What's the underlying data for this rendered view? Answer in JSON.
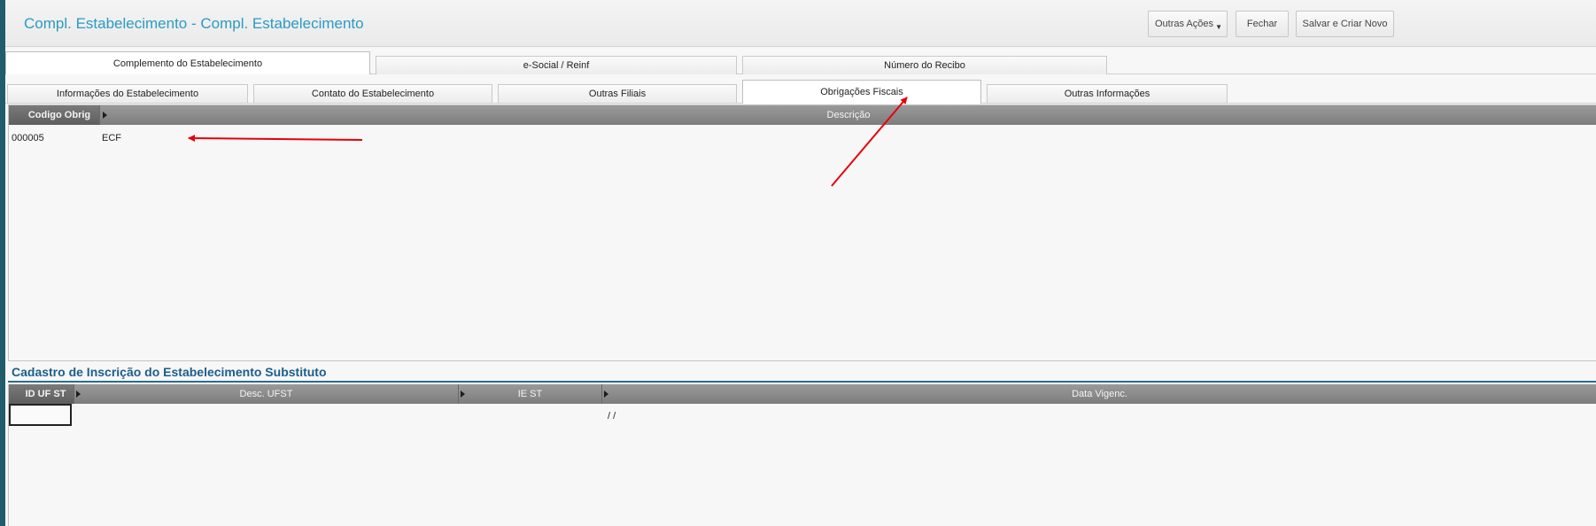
{
  "window": {
    "title": "Compl. Estabelecimento - Compl. Estabelecimento"
  },
  "toolbar": {
    "other_actions_label": "Outras Ações",
    "close_label": "Fechar",
    "save_new_label": "Salvar e Criar Novo"
  },
  "top_tabs": [
    {
      "label": "Complemento do Estabelecimento",
      "active": true
    },
    {
      "label": "e-Social / Reinf",
      "active": false
    },
    {
      "label": "Número do Recibo",
      "active": false
    }
  ],
  "sub_tabs": [
    {
      "label": "Informações do Estabelecimento",
      "active": false
    },
    {
      "label": "Contato do Estabelecimento",
      "active": false
    },
    {
      "label": "Outras Filiais",
      "active": false
    },
    {
      "label": "Obrigações Fiscais",
      "active": true
    },
    {
      "label": "Outras Informações",
      "active": false
    }
  ],
  "obligations_grid": {
    "columns": [
      "Codigo Obrig",
      "Descrição"
    ],
    "rows": [
      {
        "code": "000005",
        "description": "ECF"
      }
    ]
  },
  "substitute_section": {
    "title": "Cadastro de Inscrição do Estabelecimento Substituto",
    "columns": [
      "ID UF ST",
      "Desc. UFST",
      "IE ST",
      "Data Vigenc."
    ],
    "rows": [
      {
        "id_uf_st": "",
        "desc_ufst": "",
        "ie_st": "",
        "data_vigenc": "/ /"
      }
    ]
  },
  "colors": {
    "title": "#2a9bc3",
    "section_title": "#1a5f8a",
    "grid_header": "#7d7d7d",
    "annotation_arrow": "#e8000b"
  }
}
